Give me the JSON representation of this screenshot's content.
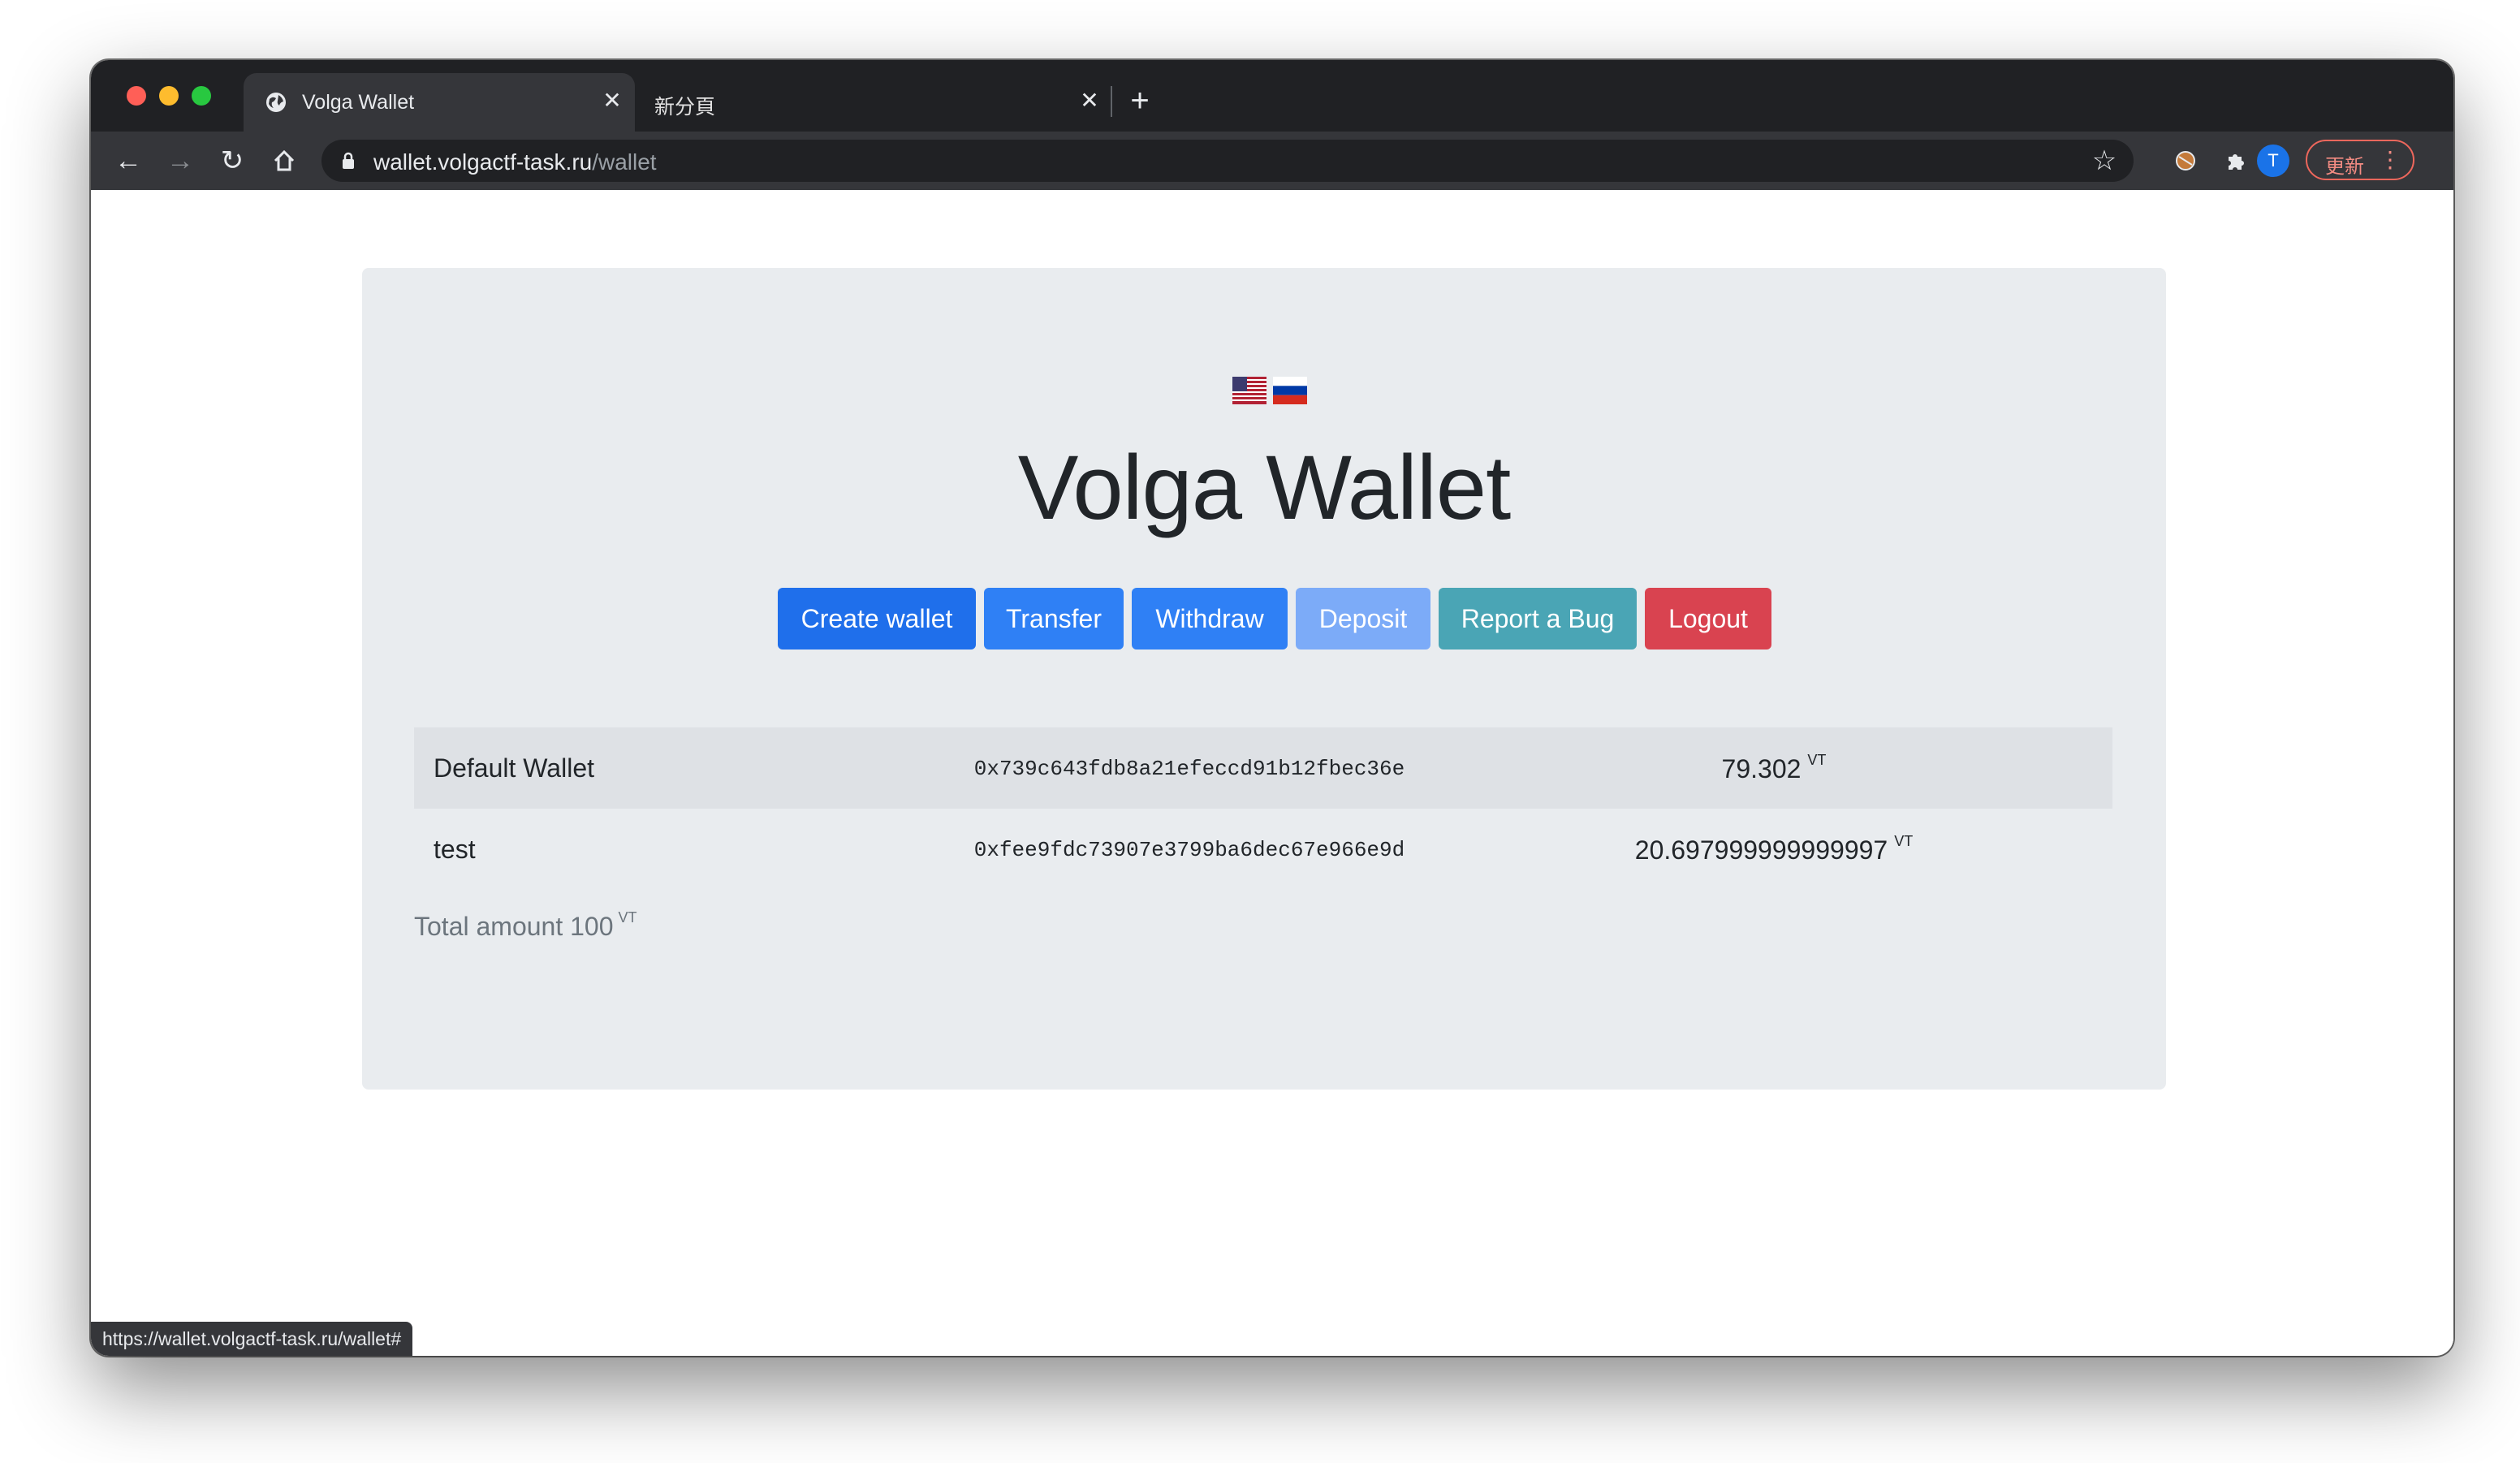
{
  "browser": {
    "tabs": [
      {
        "title": "Volga Wallet",
        "active": true
      },
      {
        "title": "新分頁",
        "active": false
      }
    ],
    "address": {
      "domain": "wallet.volgactf-task.ru",
      "path": "/wallet"
    },
    "avatar_letter": "T",
    "update_label": "更新",
    "status_url": "https://wallet.volgactf-task.ru/wallet#"
  },
  "page": {
    "languages": [
      "en-us-flag",
      "ru-flag"
    ],
    "title": "Volga Wallet",
    "buttons": {
      "create_wallet": "Create wallet",
      "transfer": "Transfer",
      "withdraw": "Withdraw",
      "deposit": "Deposit",
      "report_bug": "Report a Bug",
      "logout": "Logout"
    },
    "wallets": [
      {
        "name": "Default Wallet",
        "address": "0x739c643fdb8a21efeccd91b12fbec36e",
        "amount": "79.302",
        "currency": "VT"
      },
      {
        "name": "test",
        "address": "0xfee9fdc73907e3799ba6dec67e966e9d",
        "amount": "20.697999999999997",
        "currency": "VT"
      }
    ],
    "total": {
      "label": "Total amount",
      "value": "100",
      "currency": "VT"
    }
  },
  "colors": {
    "primary": "#1f6feb",
    "info": "#4aa5b5",
    "danger": "#d94350",
    "jumbotron": "#e9ecef"
  }
}
